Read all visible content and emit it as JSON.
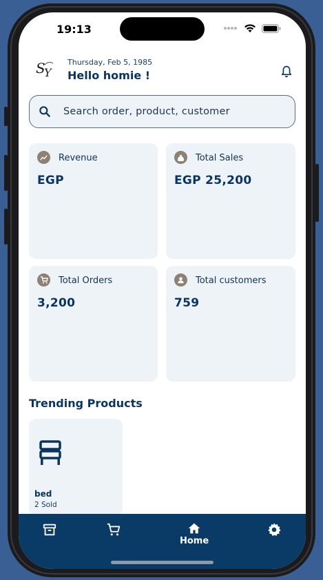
{
  "status_bar": {
    "time": "19:13"
  },
  "header": {
    "logo_text": "SY",
    "date": "Thursday, Feb 5, 1985",
    "greeting": "Hello homie !"
  },
  "search": {
    "placeholder": "Search order, product, customer"
  },
  "stats": [
    {
      "label": "Revenue",
      "value": "EGP",
      "icon": "chart-icon"
    },
    {
      "label": "Total Sales",
      "value": "EGP 25,200",
      "icon": "money-bag-icon"
    },
    {
      "label": "Total Orders",
      "value": "3,200",
      "icon": "cart-icon"
    },
    {
      "label": "Total customers",
      "value": "759",
      "icon": "user-icon"
    }
  ],
  "trending": {
    "title": "Trending Products",
    "products": [
      {
        "name": "bed",
        "sold": "2 Sold",
        "icon": "bed-icon"
      }
    ]
  },
  "bottom_nav": {
    "items": [
      {
        "icon": "archive-icon",
        "label": ""
      },
      {
        "icon": "cart-icon",
        "label": ""
      },
      {
        "icon": "home-icon",
        "label": "Home"
      },
      {
        "icon": "gear-icon",
        "label": ""
      }
    ]
  },
  "colors": {
    "primary": "#0a3a66",
    "card_bg": "#eef3f8",
    "icon_badge": "#8d8175",
    "background": "#3a5f94"
  }
}
